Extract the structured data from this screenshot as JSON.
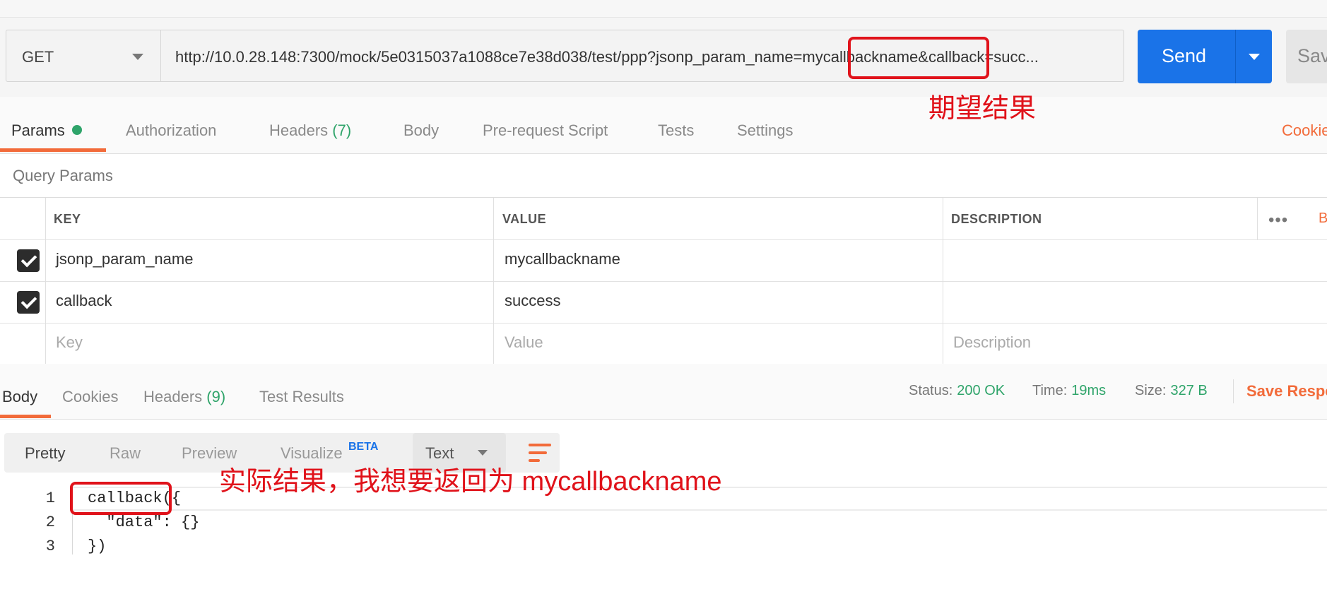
{
  "request": {
    "method": "GET",
    "url": "http://10.0.28.148:7300/mock/5e0315037a1088ce7e38d038/test/ppp?jsonp_param_name=mycallbackname&callback=succ...",
    "send_label": "Send",
    "save_label": "Sav"
  },
  "tabs": {
    "params": "Params",
    "authorization": "Authorization",
    "headers_label": "Headers",
    "headers_count": "(7)",
    "body": "Body",
    "prerequest": "Pre-request Script",
    "tests": "Tests",
    "settings": "Settings",
    "cookies": "Cookie"
  },
  "query_params": {
    "title": "Query Params",
    "columns": {
      "key": "KEY",
      "value": "VALUE",
      "description": "DESCRIPTION"
    },
    "more": "•••",
    "bulk_edit": "B",
    "rows": [
      {
        "key": "jsonp_param_name",
        "value": "mycallbackname",
        "description": "",
        "checked": true
      },
      {
        "key": "callback",
        "value": "success",
        "description": "",
        "checked": true
      }
    ],
    "placeholder": {
      "key": "Key",
      "value": "Value",
      "description": "Description"
    }
  },
  "response": {
    "tabs": {
      "body": "Body",
      "cookies": "Cookies",
      "headers_label": "Headers",
      "headers_count": "(9)",
      "test_results": "Test Results"
    },
    "status_label": "Status:",
    "status_value": "200 OK",
    "time_label": "Time:",
    "time_value": "19ms",
    "size_label": "Size:",
    "size_value": "327 B",
    "save_response": "Save Respo",
    "formats": {
      "pretty": "Pretty",
      "raw": "Raw",
      "preview": "Preview",
      "visualize": "Visualize",
      "beta": "BETA"
    },
    "text_type": "Text",
    "code_lines": [
      {
        "num": "1",
        "text": "callback({"
      },
      {
        "num": "2",
        "text": "  \"data\": {}"
      },
      {
        "num": "3",
        "text": "})"
      }
    ]
  },
  "annotations": {
    "expected": "期望结果",
    "actual": "实际结果，我想要返回为 mycallbackname",
    "color": "#e0121a"
  },
  "colors": {
    "accent": "#f26b3a",
    "send": "#1a73e8",
    "success": "#2fa46a"
  }
}
